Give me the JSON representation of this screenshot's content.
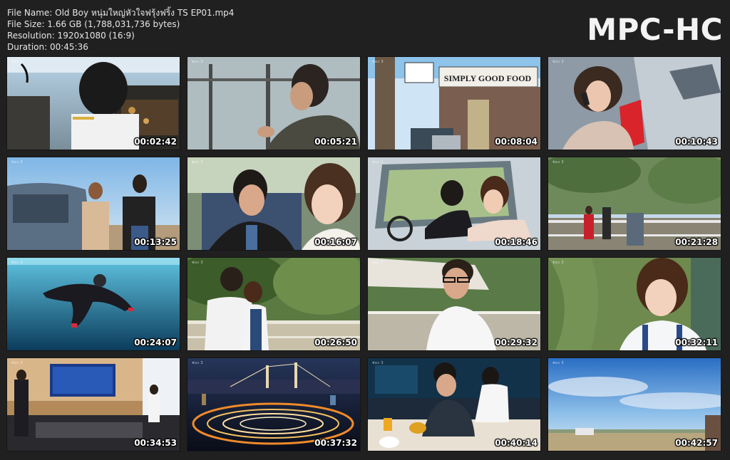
{
  "info": {
    "file_name": "File Name: Old Boy หนุ่มใหญ่หัวใจฟรุ้งฟริ้ง TS EP01.mp4",
    "file_size": "File Size: 1.66 GB (1,788,031,736 bytes)",
    "resolution": "Resolution: 1920x1080 (16:9)",
    "duration": "Duration: 00:45:36"
  },
  "logo": "MPC-HC",
  "thumbnails": [
    {
      "time": "00:02:42",
      "scene": "cockpit"
    },
    {
      "time": "00:05:21",
      "scene": "man-window"
    },
    {
      "time": "00:08:04",
      "scene": "storefront"
    },
    {
      "time": "00:10:43",
      "scene": "woman-car"
    },
    {
      "time": "00:13:25",
      "scene": "couple-car"
    },
    {
      "time": "00:16:07",
      "scene": "closeup-two"
    },
    {
      "time": "00:18:46",
      "scene": "car-interior"
    },
    {
      "time": "00:21:28",
      "scene": "park"
    },
    {
      "time": "00:24:07",
      "scene": "underwater"
    },
    {
      "time": "00:26:50",
      "scene": "balcony-couple"
    },
    {
      "time": "00:29:32",
      "scene": "glasses-man"
    },
    {
      "time": "00:32:11",
      "scene": "woman-reading"
    },
    {
      "time": "00:34:53",
      "scene": "office"
    },
    {
      "time": "00:37:32",
      "scene": "city-night"
    },
    {
      "time": "00:40:14",
      "scene": "restaurant"
    },
    {
      "time": "00:42:57",
      "scene": "landscape"
    }
  ],
  "colors": {
    "background": "#202020",
    "text": "#e6e6e6",
    "logo": "#f3f3f3"
  },
  "watermark": "ช่อง 3"
}
